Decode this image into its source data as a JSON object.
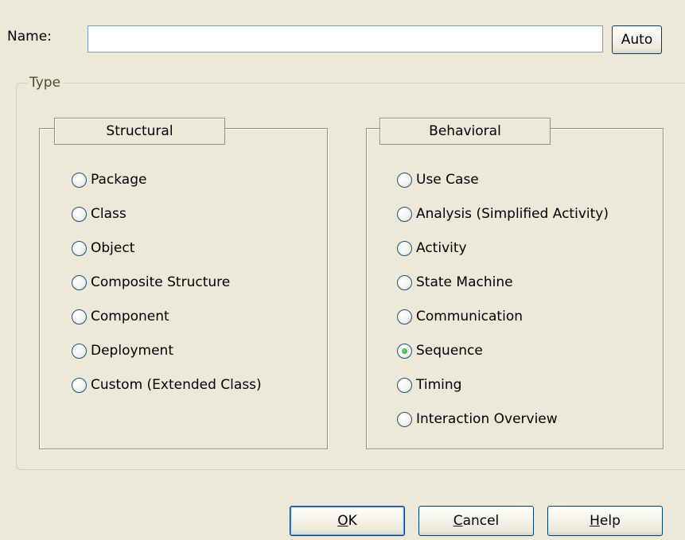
{
  "name": {
    "label": "Name:",
    "value": "",
    "auto_button": "Auto"
  },
  "type_group": {
    "label": "Type"
  },
  "structural": {
    "label": "Structural",
    "options": [
      {
        "label": "Package",
        "checked": false
      },
      {
        "label": "Class",
        "checked": false
      },
      {
        "label": "Object",
        "checked": false
      },
      {
        "label": "Composite Structure",
        "checked": false
      },
      {
        "label": "Component",
        "checked": false
      },
      {
        "label": "Deployment",
        "checked": false
      },
      {
        "label": "Custom (Extended Class)",
        "checked": false
      }
    ]
  },
  "behavioral": {
    "label": "Behavioral",
    "options": [
      {
        "label": "Use Case",
        "checked": false
      },
      {
        "label": "Analysis (Simplified Activity)",
        "checked": false
      },
      {
        "label": "Activity",
        "checked": false
      },
      {
        "label": "State Machine",
        "checked": false
      },
      {
        "label": "Communication",
        "checked": false
      },
      {
        "label": "Sequence",
        "checked": true
      },
      {
        "label": "Timing",
        "checked": false
      },
      {
        "label": "Interaction Overview",
        "checked": false
      }
    ]
  },
  "buttons": {
    "ok": {
      "mnemonic": "O",
      "rest": "K"
    },
    "cancel": {
      "mnemonic": "C",
      "rest": "ancel"
    },
    "help": {
      "mnemonic": "H",
      "rest": "elp"
    }
  }
}
